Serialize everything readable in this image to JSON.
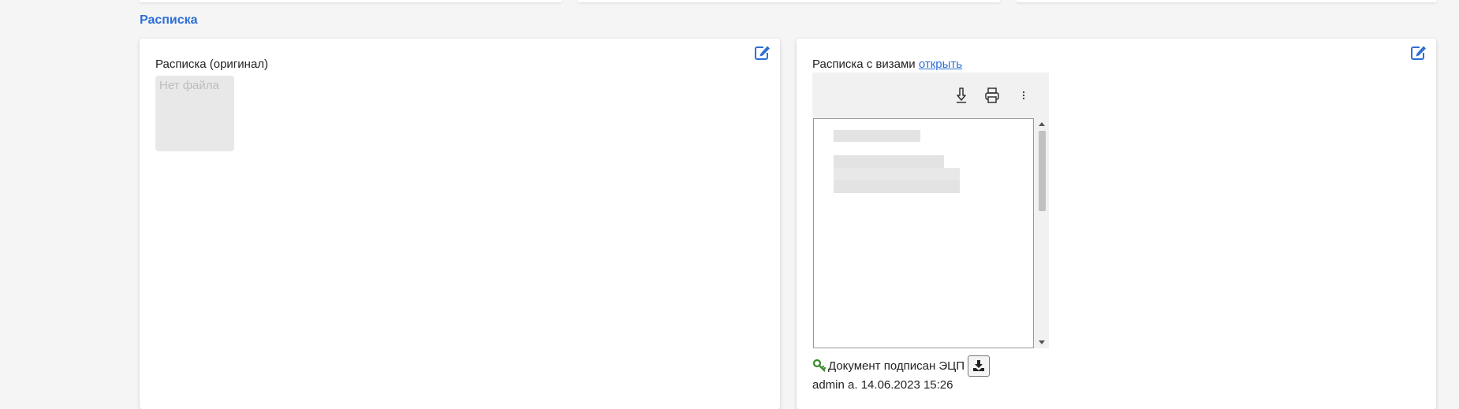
{
  "section": {
    "title": "Расписка"
  },
  "left_card": {
    "label": "Расписка (оригинал)",
    "no_file_text": "Нет файла",
    "edit_icon": "edit-icon"
  },
  "right_card": {
    "label": "Расписка с визами",
    "open_link": "открыть",
    "edit_icon": "edit-icon",
    "viewer": {
      "toolbar_icons": [
        "download-icon",
        "print-icon",
        "more-vertical-icon"
      ]
    },
    "signature": {
      "status": "Документ подписан ЭЦП",
      "status_icon": "key-icon",
      "download_icon": "download-icon",
      "signer": "admin a.",
      "datetime": "14.06.2023 15:26"
    }
  },
  "colors": {
    "accent": "#2d6fd6",
    "key_green": "#3c8a2e",
    "background": "#f5f5f5",
    "card": "#ffffff"
  }
}
